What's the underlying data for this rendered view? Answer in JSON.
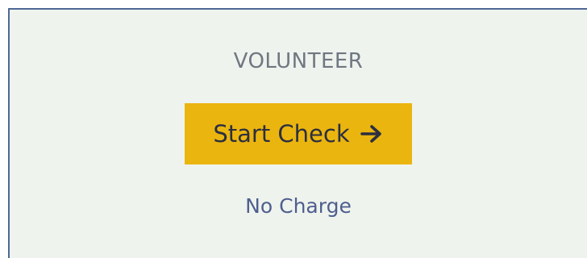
{
  "offer": {
    "title": "VOLUNTEER",
    "button_label": "Start Check",
    "button_icon": "arrow-right-icon",
    "price_text": "No Charge"
  },
  "colors": {
    "card_background": "#eff3ee",
    "card_border": "#4f6797",
    "button_background": "#ebb50f",
    "button_text": "#2c2f3f",
    "title_text": "#6f7781",
    "price_text": "#4e5f8e"
  }
}
